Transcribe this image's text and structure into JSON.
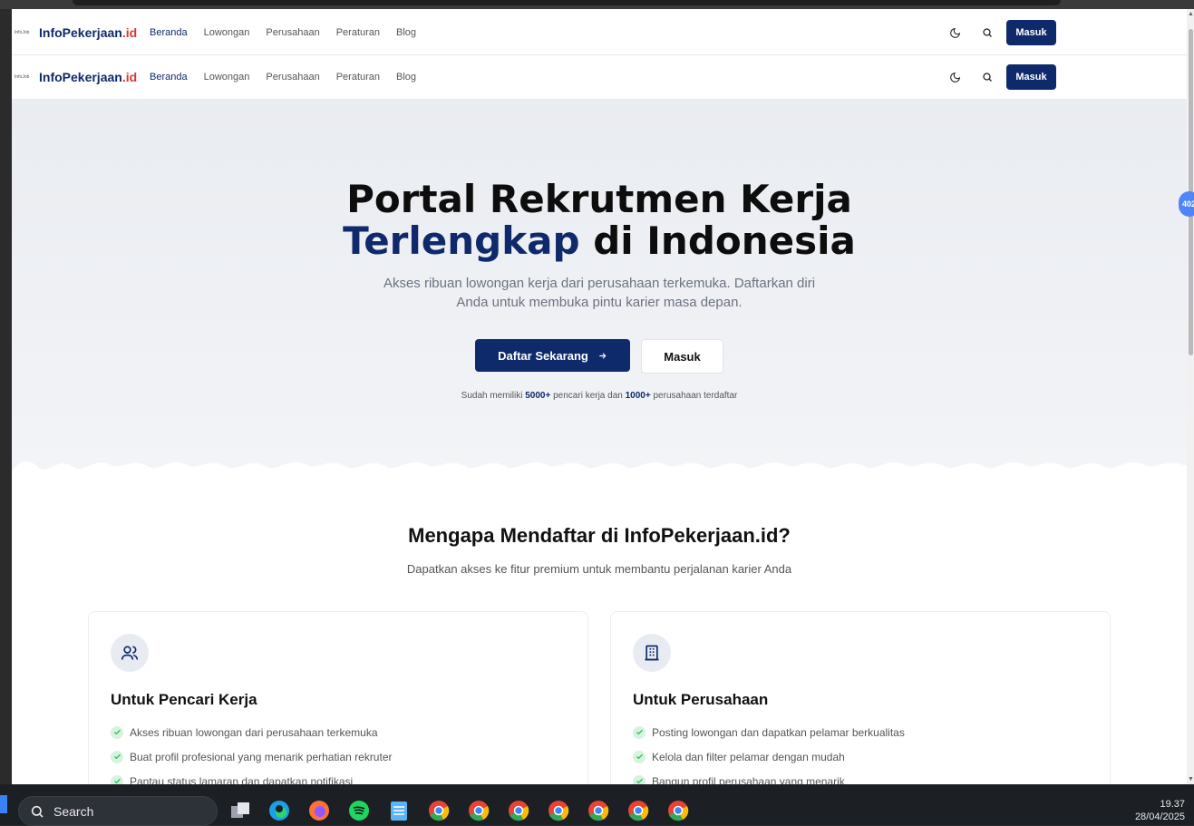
{
  "site": {
    "logo_small": "InfoJob",
    "logo_name": "InfoPekerjaan",
    "logo_tld": ".id"
  },
  "nav": {
    "items": [
      {
        "label": "Beranda"
      },
      {
        "label": "Lowongan"
      },
      {
        "label": "Perusahaan"
      },
      {
        "label": "Peraturan"
      },
      {
        "label": "Blog"
      }
    ],
    "login_label": "Masuk"
  },
  "hero": {
    "title_line1": "Portal Rekrutmen Kerja",
    "title_highlight": "Terlengkap",
    "title_rest": " di Indonesia",
    "subtitle": "Akses ribuan lowongan kerja dari perusahaan terkemuka. Daftarkan diri Anda untuk membuka pintu karier masa depan.",
    "register_label": "Daftar Sekarang",
    "login_label": "Masuk",
    "stats_prefix": "Sudah memiliki ",
    "stats_seekers": "5000+",
    "stats_mid": " pencari kerja dan ",
    "stats_companies": "1000+",
    "stats_suffix": " perusahaan terdaftar"
  },
  "features": {
    "title": "Mengapa Mendaftar di InfoPekerjaan.id?",
    "subtitle": "Dapatkan akses ke fitur premium untuk membantu perjalanan karier Anda",
    "cards": [
      {
        "icon": "users-icon",
        "title": "Untuk Pencari Kerja",
        "items": [
          "Akses ribuan lowongan dari perusahaan terkemuka",
          "Buat profil profesional yang menarik perhatian rekruter",
          "Pantau status lamaran dan dapatkan notifikasi"
        ]
      },
      {
        "icon": "building-icon",
        "title": "Untuk Perusahaan",
        "items": [
          "Posting lowongan dan dapatkan pelamar berkualitas",
          "Kelola dan filter pelamar dengan mudah",
          "Bangun profil perusahaan yang menarik"
        ]
      }
    ]
  },
  "side_badge": "402",
  "taskbar": {
    "search_placeholder": "Search",
    "time": "19.37",
    "date": "28/04/2025"
  },
  "colors": {
    "primary": "#0f2a6b",
    "accent_red": "#d93535",
    "check_green": "#22c55e"
  }
}
